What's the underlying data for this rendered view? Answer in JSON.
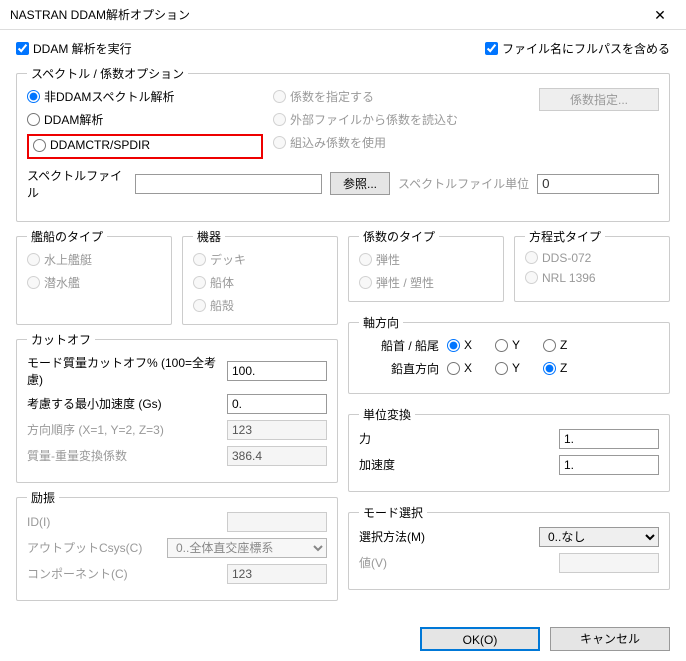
{
  "window": {
    "title": "NASTRAN DDAM解析オプション",
    "close": "✕"
  },
  "top": {
    "run_ddam": "DDAM 解析を実行",
    "fullpath": "ファイル名にフルパスを含める"
  },
  "spectrum": {
    "legend": "スペクトル / 係数オプション",
    "non_ddam": "非DDAMスペクトル解析",
    "ddam": "DDAM解析",
    "ddamctr": "DDAMCTR/SPDIR",
    "specify_coef": "係数を指定する",
    "external_coef": "外部ファイルから係数を読込む",
    "builtin_coef": "組込み係数を使用",
    "coef_btn": "係数指定..."
  },
  "file": {
    "label": "スペクトルファイル",
    "browse": "参照...",
    "unit_label": "スペクトルファイル単位",
    "unit_value": "0"
  },
  "ship": {
    "legend": "艦船のタイプ",
    "surface": "水上艦艇",
    "sub": "潜水艦"
  },
  "equipment": {
    "legend": "機器",
    "deck": "デッキ",
    "hull": "船体",
    "shell": "船殻"
  },
  "coef_type": {
    "legend": "係数のタイプ",
    "elastic": "弾性",
    "elasto_plastic": "弾性 / 塑性"
  },
  "eq_type": {
    "legend": "方程式タイプ",
    "dds": "DDS-072",
    "nrl": "NRL 1396"
  },
  "cutoff": {
    "legend": "カットオフ",
    "mass_pct": "モード質量カットオフ% (100=全考慮)",
    "mass_pct_val": "100.",
    "min_accel": "考慮する最小加速度 (Gs)",
    "min_accel_val": "0.",
    "dir_order": "方向順序 (X=1, Y=2, Z=3)",
    "dir_order_val": "123",
    "mass_conv": "質量-重量変換係数",
    "mass_conv_val": "386.4"
  },
  "axis": {
    "legend": "軸方向",
    "bow": "船首 / 船尾",
    "vertical": "鉛直方向",
    "x": "X",
    "y": "Y",
    "z": "Z"
  },
  "unit_conv": {
    "legend": "単位変換",
    "force": "力",
    "force_val": "1.",
    "accel": "加速度",
    "accel_val": "1."
  },
  "excitation": {
    "legend": "励振",
    "id": "ID(I)",
    "csys": "アウトプットCsys(C)",
    "csys_val": "0..全体直交座標系",
    "component": "コンポーネント(C)",
    "component_val": "123"
  },
  "mode_sel": {
    "legend": "モード選択",
    "method": "選択方法(M)",
    "method_val": "0..なし",
    "value": "値(V)"
  },
  "footer": {
    "ok": "OK(O)",
    "cancel": "キャンセル"
  }
}
